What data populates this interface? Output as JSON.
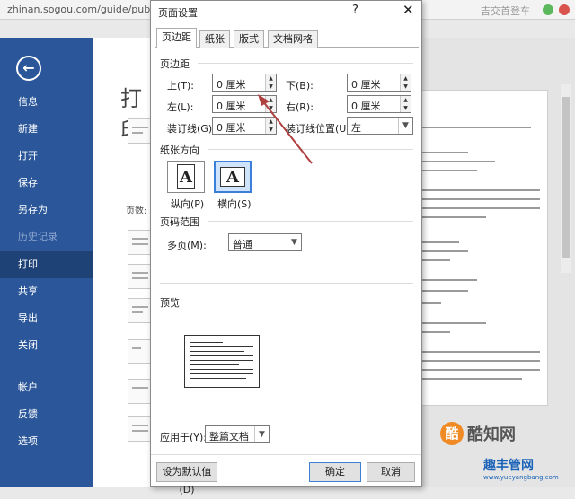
{
  "browser": {
    "url": "zhinan.sogou.com/guide/publish?",
    "right_text": "吉交首登车"
  },
  "backstage": {
    "back_icon": "back-arrow-icon",
    "nav": [
      "信息",
      "新建",
      "打开",
      "保存",
      "另存为",
      "历史记录",
      "打印",
      "共享",
      "导出",
      "关闭",
      "帐户",
      "反馈",
      "选项"
    ],
    "title": "打印",
    "pages_label": "页数:"
  },
  "dialog": {
    "title": "页面设置",
    "help": "?",
    "close": "✕",
    "tabs": [
      "页边距",
      "纸张",
      "版式",
      "文档网格"
    ],
    "margins": {
      "section": "页边距",
      "top_label": "上(T):",
      "top_value": "0 厘米",
      "bottom_label": "下(B):",
      "bottom_value": "0 厘米",
      "left_label": "左(L):",
      "left_value": "0 厘米",
      "right_label": "右(R):",
      "right_value": "0 厘米",
      "gutter_label": "装订线(G):",
      "gutter_value": "0 厘米",
      "gutter_pos_label": "装订线位置(U):",
      "gutter_pos_value": "左"
    },
    "orientation": {
      "section": "纸张方向",
      "portrait": "纵向(P)",
      "landscape": "横向(S)",
      "glyph": "A"
    },
    "pages": {
      "section": "页码范围",
      "multi_label": "多页(M):",
      "multi_value": "普通"
    },
    "preview": {
      "section": "预览"
    },
    "apply": {
      "label": "应用于(Y):",
      "value": "整篇文档"
    },
    "buttons": {
      "default": "设为默认值(D)",
      "ok": "确定",
      "cancel": "取消"
    }
  },
  "watermark": {
    "brand": "酷知网",
    "brand2": "趣丰管网",
    "url": "www.yueyangbang.com"
  },
  "colors": {
    "word_blue": "#2b579a",
    "arrow": "#b04040"
  }
}
